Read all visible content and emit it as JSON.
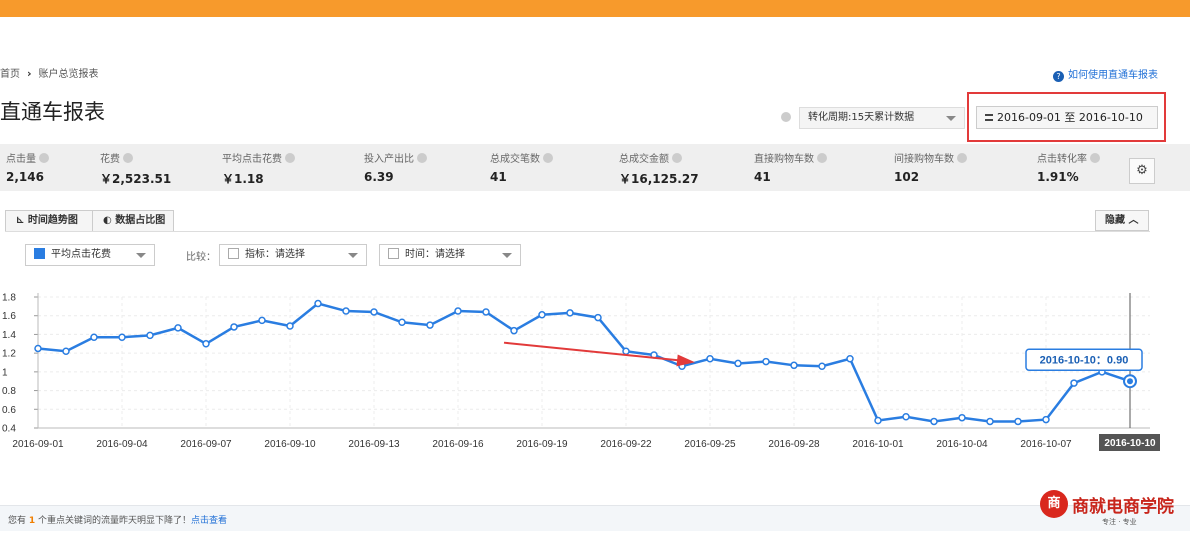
{
  "topbar": {
    "user_text": ""
  },
  "breadcrumb": {
    "home": "首页",
    "current": "账户总览报表"
  },
  "help_link": "如何使用直通车报表",
  "page_title": "直通车报表",
  "period_select": "转化周期:15天累计数据",
  "date_range": "2016-09-01 至 2016-10-10",
  "metrics": [
    {
      "label": "点击量",
      "value": "2,146"
    },
    {
      "label": "花费",
      "value": "￥2,523.51"
    },
    {
      "label": "平均点击花费",
      "value": "￥1.18"
    },
    {
      "label": "投入产出比",
      "value": "6.39"
    },
    {
      "label": "总成交笔数",
      "value": "41"
    },
    {
      "label": "总成交金额",
      "value": "￥16,125.27"
    },
    {
      "label": "直接购物车数",
      "value": "41"
    },
    {
      "label": "间接购物车数",
      "value": "102"
    },
    {
      "label": "点击转化率",
      "value": "1.91%"
    }
  ],
  "tabs": {
    "trend": "时间趋势图",
    "share": "数据占比图"
  },
  "hide_button": "隐藏",
  "controls": {
    "metric_select": "平均点击花费",
    "compare_label": "比较：",
    "indicator_select": "指标：请选择",
    "time_select": "时间：请选择"
  },
  "chart_data": {
    "type": "line",
    "series_color": "#2a7de1",
    "ylim": [
      0.4,
      1.8
    ],
    "yticks": [
      "1.8",
      "1.6",
      "1.4",
      "1.2",
      "1",
      "0.8",
      "0.6",
      "0.4"
    ],
    "xtick_labels": [
      "2016-09-01",
      "2016-09-04",
      "2016-09-07",
      "2016-09-10",
      "2016-09-13",
      "2016-09-16",
      "2016-09-19",
      "2016-09-22",
      "2016-09-25",
      "2016-09-28",
      "2016-10-01",
      "2016-10-04",
      "2016-10-07",
      "2016-10-10"
    ],
    "x": [
      "2016-09-01",
      "2016-09-02",
      "2016-09-03",
      "2016-09-04",
      "2016-09-05",
      "2016-09-06",
      "2016-09-07",
      "2016-09-08",
      "2016-09-09",
      "2016-09-10",
      "2016-09-11",
      "2016-09-12",
      "2016-09-13",
      "2016-09-14",
      "2016-09-15",
      "2016-09-16",
      "2016-09-17",
      "2016-09-18",
      "2016-09-19",
      "2016-09-20",
      "2016-09-21",
      "2016-09-22",
      "2016-09-23",
      "2016-09-24",
      "2016-09-25",
      "2016-09-26",
      "2016-09-27",
      "2016-09-28",
      "2016-09-29",
      "2016-09-30",
      "2016-10-01",
      "2016-10-02",
      "2016-10-03",
      "2016-10-04",
      "2016-10-05",
      "2016-10-06",
      "2016-10-07",
      "2016-10-08",
      "2016-10-09",
      "2016-10-10"
    ],
    "values": [
      1.25,
      1.22,
      1.37,
      1.37,
      1.39,
      1.47,
      1.3,
      1.48,
      1.55,
      1.49,
      1.73,
      1.65,
      1.64,
      1.53,
      1.5,
      1.65,
      1.64,
      1.44,
      1.61,
      1.63,
      1.58,
      1.22,
      1.18,
      1.06,
      1.14,
      1.09,
      1.11,
      1.07,
      1.06,
      1.14,
      0.48,
      0.52,
      0.47,
      0.51,
      0.47,
      0.47,
      0.49,
      0.88,
      1.0,
      0.9
    ],
    "tooltip": "2016-10-10：0.90",
    "crosshair_label": "2016-10-10",
    "grid": true
  },
  "bottom_notice": {
    "prefix": "您有",
    "count": "1",
    "suffix": "个重点关键词的流量昨天明显下降了！",
    "link": "点击查看"
  },
  "logo": {
    "name": "商就电商学院",
    "tagline": "专注 · 专业"
  }
}
